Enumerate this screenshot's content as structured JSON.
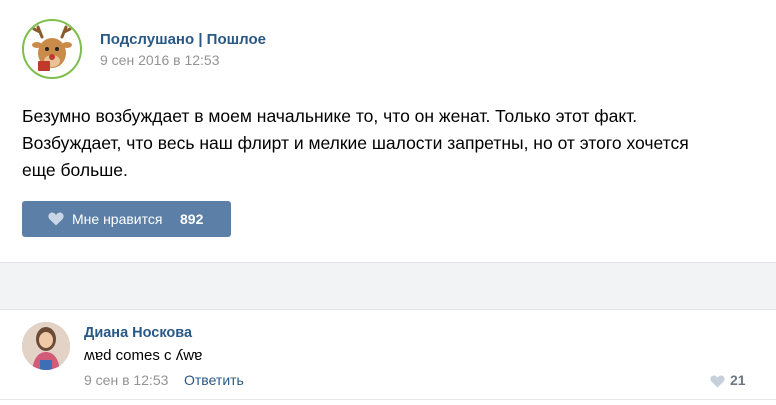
{
  "post": {
    "group_name": "Подслушано | Пошлое",
    "date": "9 сен 2016 в 12:53",
    "text_lines": [
      "Безумно возбуждает в моем начальнике то, что он женат. Только этот факт.",
      "Возбуждает, что весь наш флирт и мелкие шалости запретны, но от этого хочется",
      "еще больше."
    ],
    "like_label": "Мне нравится",
    "like_count": "892"
  },
  "comment": {
    "author": "Диана Носкова",
    "text": "ʍɐd comes c ʎwɐ",
    "date": "9 сен в 12:53",
    "reply_label": "Ответить",
    "like_count": "21"
  },
  "icons": {
    "group_avatar": "reindeer-avatar-icon",
    "like": "heart-icon"
  },
  "colors": {
    "link": "#2a5885",
    "like_button": "#5b7fa6",
    "muted": "#939393"
  }
}
